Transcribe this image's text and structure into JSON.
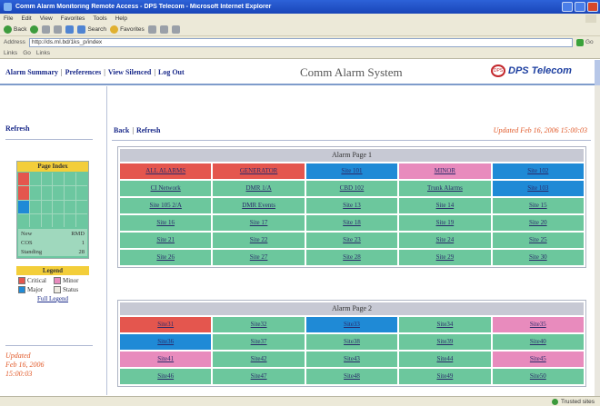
{
  "window": {
    "title": "Comm Alarm Monitoring Remote Access - DPS Telecom - Microsoft Internet Explorer"
  },
  "menu": [
    "File",
    "Edit",
    "View",
    "Favorites",
    "Tools",
    "Help"
  ],
  "toolbar": {
    "back": "Back",
    "search": "Search",
    "favorites": "Favorites"
  },
  "address": {
    "label": "Address",
    "url": "http://ds.ml.bd/1ks_p/index",
    "go": "Go"
  },
  "links": {
    "label": "Links",
    "items": [
      "Go",
      "Links"
    ]
  },
  "header": {
    "nav": [
      "Alarm Summary",
      "Preferences",
      "View Silenced",
      "Log Out"
    ],
    "system_title": "Comm Alarm System",
    "brand": "DPS Telecom",
    "brand_mark": "DPS"
  },
  "sidebar": {
    "refresh": "Refresh",
    "page_index": {
      "title": "Page Index",
      "stats": [
        {
          "label": "New",
          "value": "RMD"
        },
        {
          "label": "COS",
          "value": "1"
        },
        {
          "label": "Standing",
          "value": "28"
        }
      ]
    },
    "legend": {
      "title": "Legend",
      "items": [
        {
          "label": "Critical",
          "color": "#e4564e"
        },
        {
          "label": "Minor",
          "color": "#e88bbd"
        },
        {
          "label": "Major",
          "color": "#1f8ad6"
        },
        {
          "label": "Status",
          "color": "#ece9df"
        }
      ],
      "full_link": "Full Legend"
    },
    "updated": [
      "Updated",
      "Feb 16, 2006",
      "15:00:03"
    ]
  },
  "main": {
    "nav": [
      "Back",
      "Refresh"
    ],
    "updated": "Updated Feb 16, 2006 15:00:03",
    "pages": [
      {
        "title": "Alarm Page 1",
        "cells": [
          {
            "label": "ALL ALARMS",
            "status": "critical"
          },
          {
            "label": "GENERATOR",
            "status": "critical"
          },
          {
            "label": "Site 101",
            "status": "major"
          },
          {
            "label": "MINOR",
            "status": "minor"
          },
          {
            "label": "Site 102",
            "status": "major"
          },
          {
            "label": "CI Network",
            "status": "ok"
          },
          {
            "label": "DMR 1/A",
            "status": "ok"
          },
          {
            "label": "CBD 102",
            "status": "ok"
          },
          {
            "label": "Trunk Alarms",
            "status": "ok"
          },
          {
            "label": "Site 103",
            "status": "major"
          },
          {
            "label": "Site 105 2/A",
            "status": "ok"
          },
          {
            "label": "DMR Events",
            "status": "ok"
          },
          {
            "label": "Site 13",
            "status": "ok"
          },
          {
            "label": "Site 14",
            "status": "ok"
          },
          {
            "label": "Site 15",
            "status": "ok"
          },
          {
            "label": "Site 16",
            "status": "ok"
          },
          {
            "label": "Site 17",
            "status": "ok"
          },
          {
            "label": "Site 18",
            "status": "ok"
          },
          {
            "label": "Site 19",
            "status": "ok"
          },
          {
            "label": "Site 20",
            "status": "ok"
          },
          {
            "label": "Site 21",
            "status": "ok"
          },
          {
            "label": "Site 22",
            "status": "ok"
          },
          {
            "label": "Site 23",
            "status": "ok"
          },
          {
            "label": "Site 24",
            "status": "ok"
          },
          {
            "label": "Site 25",
            "status": "ok"
          },
          {
            "label": "Site 26",
            "status": "ok"
          },
          {
            "label": "Site 27",
            "status": "ok"
          },
          {
            "label": "Site 28",
            "status": "ok"
          },
          {
            "label": "Site 29",
            "status": "ok"
          },
          {
            "label": "Site 30",
            "status": "ok"
          }
        ]
      },
      {
        "title": "Alarm Page 2",
        "cells": [
          {
            "label": "Site31",
            "status": "critical"
          },
          {
            "label": "Site32",
            "status": "ok"
          },
          {
            "label": "Site33",
            "status": "major"
          },
          {
            "label": "Site34",
            "status": "ok"
          },
          {
            "label": "Site35",
            "status": "minor"
          },
          {
            "label": "Site36",
            "status": "major"
          },
          {
            "label": "Site37",
            "status": "ok"
          },
          {
            "label": "Site38",
            "status": "ok"
          },
          {
            "label": "Site39",
            "status": "ok"
          },
          {
            "label": "Site40",
            "status": "ok"
          },
          {
            "label": "Site41",
            "status": "minor"
          },
          {
            "label": "Site42",
            "status": "ok"
          },
          {
            "label": "Site43",
            "status": "ok"
          },
          {
            "label": "Site44",
            "status": "ok"
          },
          {
            "label": "Site45",
            "status": "minor"
          },
          {
            "label": "Site46",
            "status": "ok"
          },
          {
            "label": "Site47",
            "status": "ok"
          },
          {
            "label": "Site48",
            "status": "ok"
          },
          {
            "label": "Site49",
            "status": "ok"
          },
          {
            "label": "Site50",
            "status": "ok"
          }
        ]
      }
    ]
  },
  "status_colors": {
    "critical": "#e4564e",
    "major": "#1f8ad6",
    "minor": "#e88bbd",
    "ok": "#6cc79d"
  },
  "statusbar": {
    "zone": "Trusted sites"
  }
}
